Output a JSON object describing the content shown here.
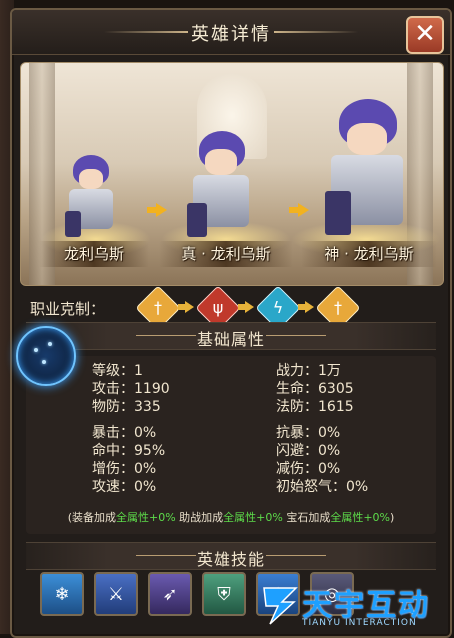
{
  "header": {
    "title": "英雄详情",
    "close_label": "✕"
  },
  "evolution": {
    "stages": [
      {
        "name": "龙利乌斯"
      },
      {
        "name": "真 · 龙利乌斯"
      },
      {
        "name": "神 · 龙利乌斯"
      }
    ]
  },
  "class_row": {
    "label": "职业克制：",
    "icons": [
      {
        "icon": "sword-icon",
        "glyph": "†",
        "color": "#e8a83a"
      },
      {
        "icon": "rune-icon",
        "glyph": "ψ",
        "color": "#c0392b"
      },
      {
        "icon": "lightning-icon",
        "glyph": "ϟ",
        "color": "#2aa7c9"
      },
      {
        "icon": "sword-icon",
        "glyph": "†",
        "color": "#e8a83a"
      }
    ]
  },
  "basic_stats": {
    "heading": "基础属性",
    "rows": [
      {
        "left": "等级：1",
        "right": "战力：1万"
      },
      {
        "left": "攻击：1190",
        "right": "生命：6305"
      },
      {
        "left": "物防：335",
        "right": "法防：1615"
      },
      {
        "left": "暴击：0%",
        "right": "抗暴：0%"
      },
      {
        "left": "命中：95%",
        "right": "闪避：0%"
      },
      {
        "left": "增伤：0%",
        "right": "减伤：0%"
      },
      {
        "left": "攻速：0%",
        "right": "初始怒气：0%"
      }
    ],
    "bonus": {
      "open": "(",
      "p1": "装备加成",
      "g1": "全属性+0%",
      "p2": " 助战加成",
      "g2": "全属性+0%",
      "p3": " 宝石加成",
      "g3": "全属性+0%",
      "close": ")"
    }
  },
  "skills": {
    "heading": "英雄技能",
    "items": [
      {
        "icon": "frost-skill-icon",
        "glyph": "❄",
        "color": "#2f7dc4"
      },
      {
        "icon": "slash-skill-icon",
        "glyph": "⚔",
        "color": "#3a5fb0"
      },
      {
        "icon": "spear-skill-icon",
        "glyph": "➶",
        "color": "#5a4a9a"
      },
      {
        "icon": "shield-skill-icon",
        "glyph": "⛨",
        "color": "#3e8a6a"
      },
      {
        "icon": "burst-skill-icon",
        "glyph": "✶",
        "color": "#2c6cc0"
      },
      {
        "icon": "orb-skill-icon",
        "glyph": "◎",
        "color": "#4a4a6a"
      }
    ]
  },
  "watermark": {
    "text": "天宇互动",
    "subtext": "TIANYU INTERACTION"
  }
}
